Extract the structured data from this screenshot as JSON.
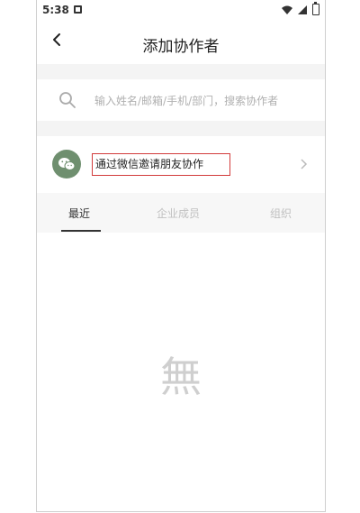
{
  "status_bar": {
    "time": "5:38"
  },
  "header": {
    "title": "添加协作者",
    "back_icon": "chevron-left-icon"
  },
  "search": {
    "placeholder": "输入姓名/邮箱/手机/部门，搜索协作者",
    "value": "",
    "icon": "search-icon"
  },
  "invite": {
    "label": "通过微信邀请朋友协作",
    "icon": "wechat-icon",
    "highlight_color": "#d23b3b",
    "avatar_color": "#6f8f6f"
  },
  "tabs": [
    {
      "label": "最近",
      "active": true
    },
    {
      "label": "企业成员",
      "active": false
    },
    {
      "label": "组织",
      "active": false
    }
  ],
  "empty_state": {
    "text": "無"
  }
}
